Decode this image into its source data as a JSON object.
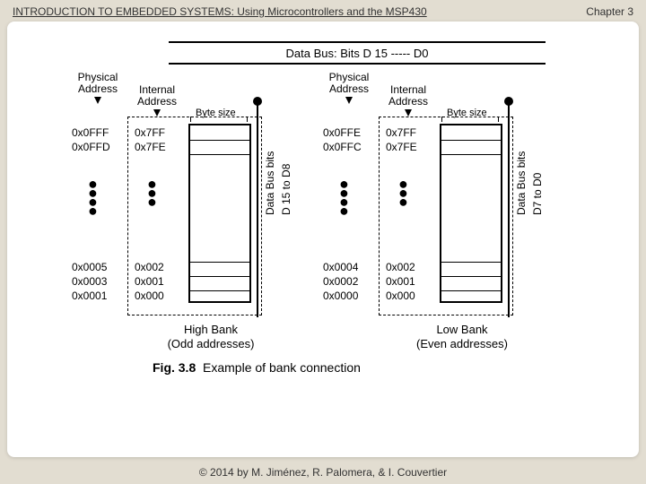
{
  "header": {
    "left": "INTRODUCTION TO EMBEDDED SYSTEMS: Using Microcontrollers and the MSP430",
    "right": "Chapter 3"
  },
  "footer": "© 2014 by M. Jiménez, R. Palomera, & I. Couvertier",
  "diagram": {
    "data_bus_header": "Data  Bus:   Bits   D 15 -----  D0",
    "phys_label": "Physical Address",
    "int_label": "Internal Address",
    "byte_size": "Byte size",
    "bus_text": "Data Bus bits",
    "high": {
      "title": "High Bank",
      "subtitle": "(Odd addresses)",
      "bits": "D 15 to  D8",
      "phys_top_1": "0x0FFF",
      "phys_top_2": "0x0FFD",
      "phys_bot_1": "0x0005",
      "phys_bot_2": "0x0003",
      "phys_bot_3": "0x0001",
      "int_top_1": "0x7FF",
      "int_top_2": "0x7FE",
      "int_bot_1": "0x002",
      "int_bot_2": "0x001",
      "int_bot_3": "0x000"
    },
    "low": {
      "title": "Low Bank",
      "subtitle": "(Even addresses)",
      "bits": "D7 to  D0",
      "phys_top_1": "0x0FFE",
      "phys_top_2": "0x0FFC",
      "phys_bot_1": "0x0004",
      "phys_bot_2": "0x0002",
      "phys_bot_3": "0x0000",
      "int_top_1": "0x7FF",
      "int_top_2": "0x7FE",
      "int_bot_1": "0x002",
      "int_bot_2": "0x001",
      "int_bot_3": "0x000"
    },
    "caption_label": "Fig. 3.8",
    "caption_text": "Example of bank connection"
  }
}
